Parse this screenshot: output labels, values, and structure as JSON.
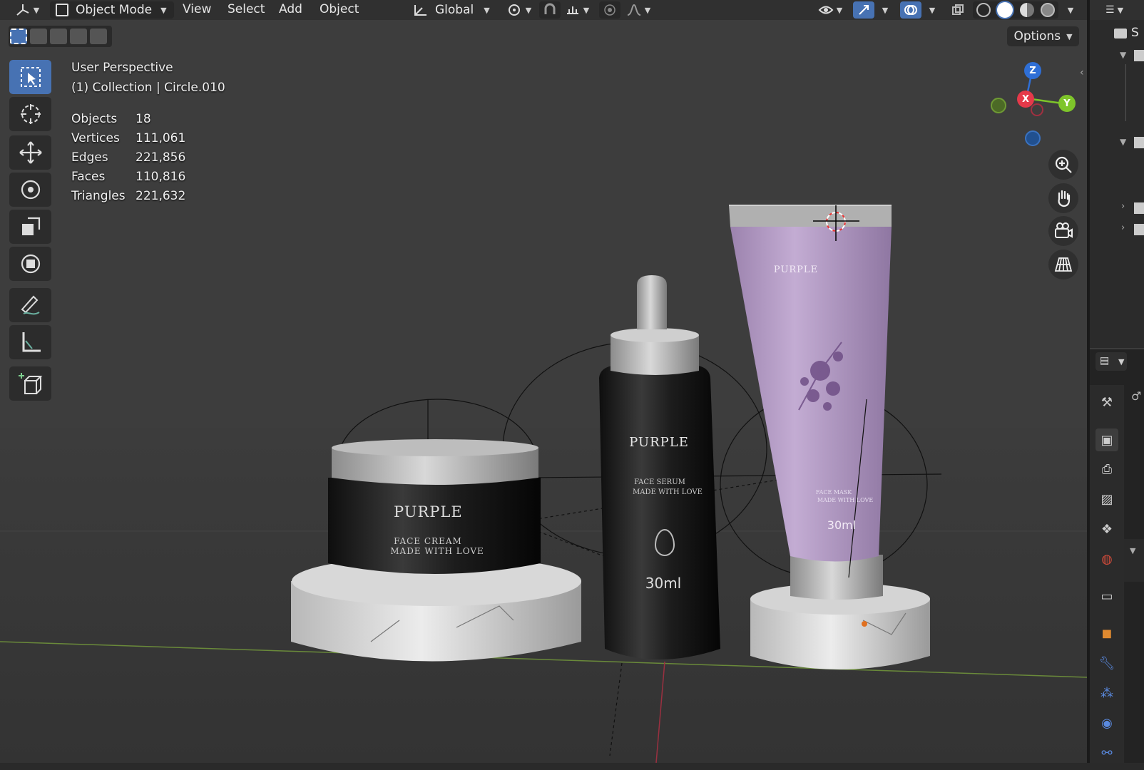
{
  "header": {
    "editor_type_icon": "axis-icon",
    "mode_label": "Object Mode",
    "menus": [
      "View",
      "Select",
      "Add",
      "Object"
    ],
    "orientation_label": "Global"
  },
  "options_label": "Options",
  "viewport": {
    "view_name": "User Perspective",
    "collection_line": "(1) Collection | Circle.010",
    "stats": [
      {
        "label": "Objects",
        "value": "18"
      },
      {
        "label": "Vertices",
        "value": "111,061"
      },
      {
        "label": "Edges",
        "value": "221,856"
      },
      {
        "label": "Faces",
        "value": "110,816"
      },
      {
        "label": "Triangles",
        "value": "221,632"
      }
    ]
  },
  "gizmo": {
    "z": "Z",
    "x": "X",
    "y": "Y"
  },
  "products": {
    "jar": {
      "brand": "PURPLE",
      "line1": "FACE CREAM",
      "line2": "MADE WITH LOVE"
    },
    "bottle": {
      "brand": "PURPLE",
      "line1": "FACE SERUM",
      "line2": "MADE WITH LOVE",
      "volume": "30ml"
    },
    "tube": {
      "brand": "PURPLE",
      "line1": "FACE MASK",
      "line2": "MADE WITH LOVE",
      "volume": "30ml"
    }
  },
  "outliner_partial": "S",
  "colors": {
    "active_blue": "#4772b3",
    "axis_x": "#e5394a",
    "axis_y": "#7ec52a",
    "axis_z": "#2f6fd6",
    "tube_purple": "#b49ac6"
  }
}
